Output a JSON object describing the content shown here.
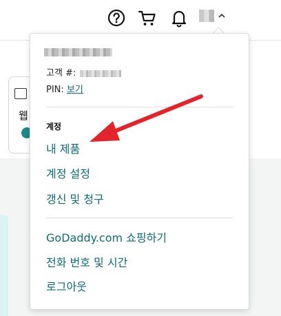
{
  "header": {
    "help_icon": "question-circle-icon",
    "cart_icon": "shopping-cart-icon",
    "notification_icon": "bell-icon",
    "account_caret_icon": "chevron-up-icon"
  },
  "background": {
    "card_text": "웹"
  },
  "account_menu": {
    "customer_label": "고객 #:",
    "pin_label": "PIN:",
    "pin_link": "보기",
    "section_heading": "계정",
    "items": [
      {
        "label": "내 제품"
      },
      {
        "label": "계정 설정"
      },
      {
        "label": "갱신 및 청구"
      }
    ],
    "secondary_items": [
      {
        "label": "GoDaddy.com 쇼핑하기"
      },
      {
        "label": "전화 번호 및 시간"
      },
      {
        "label": "로그아웃"
      }
    ]
  },
  "colors": {
    "link": "#0a6e73",
    "annotation_arrow": "#e3242b",
    "teal_badge": "#1b8a88"
  }
}
